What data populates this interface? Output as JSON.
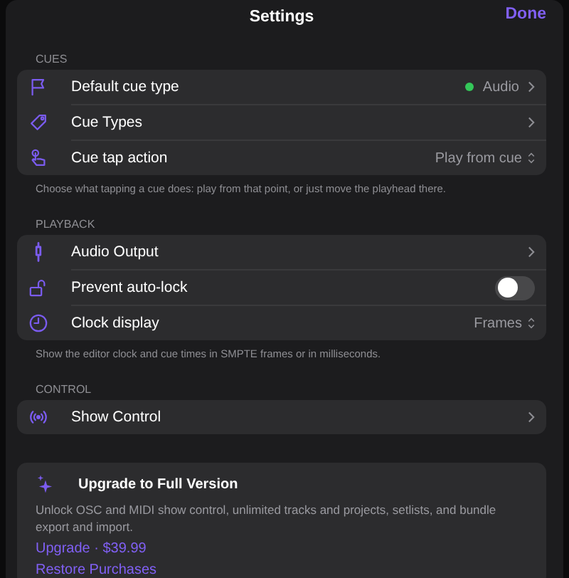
{
  "nav": {
    "title": "Settings",
    "done": "Done"
  },
  "sections": [
    {
      "header": "CUES",
      "rows": [
        {
          "kind": "value",
          "label": "Default cue type",
          "value": "Audio",
          "color": "#34c759"
        },
        {
          "kind": "link",
          "label": "Cue Types"
        },
        {
          "kind": "picker",
          "label": "Cue tap action",
          "value": "Play from cue"
        }
      ],
      "footer": "Choose what tapping a cue does: play from that point, or just move the playhead there."
    },
    {
      "header": "PLAYBACK",
      "rows": [
        {
          "kind": "link",
          "label": "Audio Output"
        },
        {
          "kind": "toggle",
          "label": "Prevent auto-lock",
          "on": false
        },
        {
          "kind": "picker",
          "label": "Clock display",
          "value": "Frames"
        }
      ],
      "footer": "Show the editor clock and cue times in SMPTE frames or in milliseconds."
    },
    {
      "header": "CONTROL",
      "rows": [
        {
          "kind": "link",
          "label": "Show Control"
        }
      ]
    }
  ],
  "upgrade": {
    "title": "Upgrade to Full Version",
    "text": "Unlock OSC and MIDI show control, unlimited tracks and projects, setlists, and bundle export and import.",
    "buy": "Upgrade · $39.99",
    "restore": "Restore Purchases"
  }
}
